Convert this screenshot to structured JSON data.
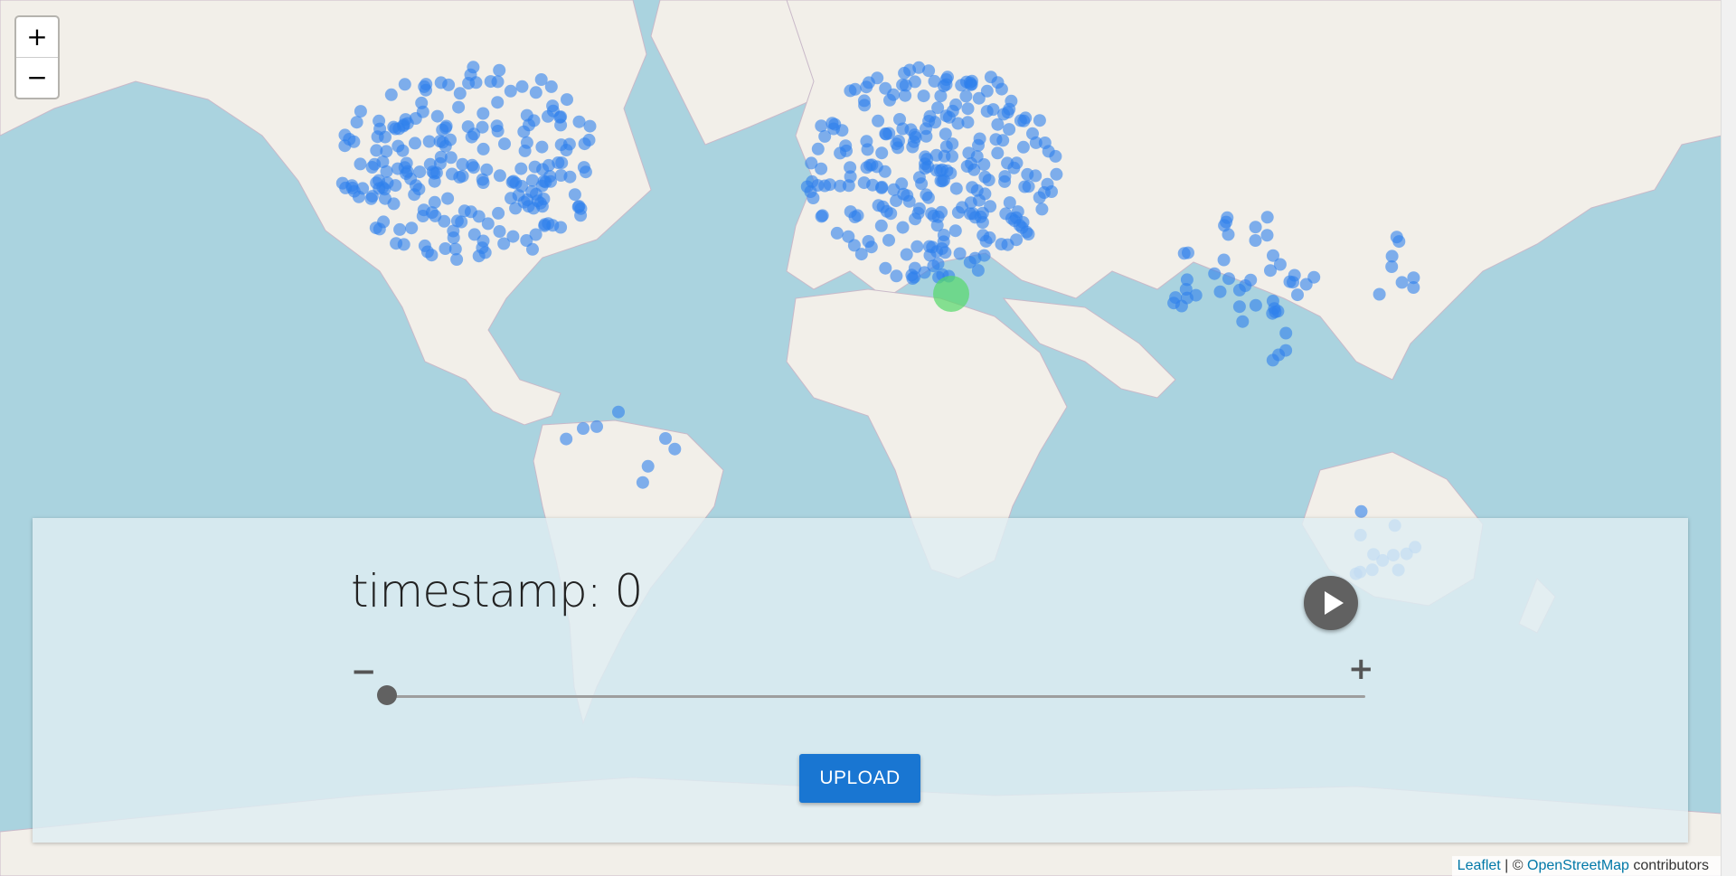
{
  "map": {
    "zoom_in_label": "+",
    "zoom_out_label": "−",
    "ocean_color": "#aad3df",
    "land_color": "#f2efe9",
    "marker_color": "#2f80ed",
    "highlight_color": "#55d86a"
  },
  "controls": {
    "timestamp_label": "timestamp: 0",
    "decrement_label": "−",
    "increment_label": "+",
    "slider_value": 0,
    "upload_label": "UPLOAD",
    "play_icon": "play-icon"
  },
  "attribution": {
    "leaflet": "Leaflet",
    "separator": " | © ",
    "osm": "OpenStreetMap",
    "suffix": " contributors"
  }
}
